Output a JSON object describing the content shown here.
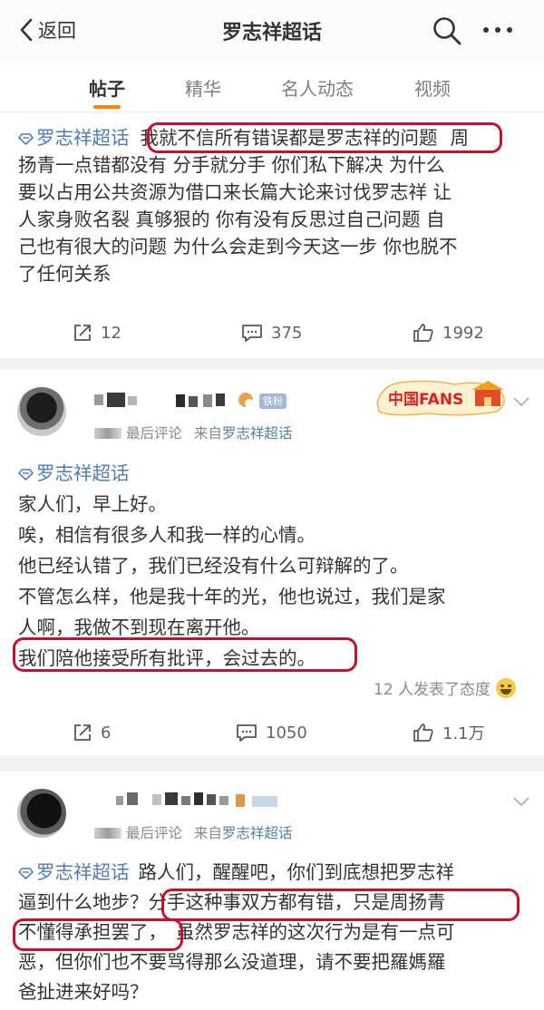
{
  "nav": {
    "back_label": "返回",
    "title": "罗志祥超话"
  },
  "tabs": [
    {
      "label": "帖子",
      "active": true
    },
    {
      "label": "精华",
      "active": false
    },
    {
      "label": "名人动态",
      "active": false
    },
    {
      "label": "视频",
      "active": false
    }
  ],
  "colors": {
    "accent": "#ff8200",
    "link": "#507daf",
    "highlight_circle": "#c8102e",
    "background": "#f2f2f2"
  },
  "posts": [
    {
      "topic_tag": "罗志祥超话",
      "text_lines": [
        "我就不信所有错误都是罗志祥的问题",
        "周",
        "扬青一点错都没有  分手就分手  你们私下解决  为什么",
        "要以占用公共资源为借口来长篇大论来讨伐罗志祥  让",
        "人家身败名裂  真够狠的  你有没有反思过自己问题  自",
        "己也有很大的问题  为什么会走到今天这一步  你也脱不",
        "了任何关系"
      ],
      "reposts": "12",
      "comments": "375",
      "likes": "1992"
    },
    {
      "author_badge": "铁粉",
      "meta_prefix": "最后评论",
      "meta_from": "来自",
      "meta_source": "罗志祥超话",
      "topic_tag": "罗志祥超话",
      "text_lines": [
        "家人们，早上好。",
        "唉，相信有很多人和我一样的心情。",
        "他已经认错了，我们已经没有什么可辩解的了。",
        "不管怎么样，他是我十年的光，他也说过，我们是家",
        "人啊，我做不到现在离开他。",
        "我们陪他接受所有批评，会过去的。"
      ],
      "fans_badge": "中国FANS",
      "attitude_text": "12 人发表了态度",
      "reposts": "6",
      "comments": "1050",
      "likes": "1.1万"
    },
    {
      "meta_prefix": "最后评论",
      "meta_from": "来自",
      "meta_source": "罗志祥超话",
      "topic_tag": "罗志祥超话",
      "text_lines": [
        "路人们，醒醒吧，你们到底想把罗志祥",
        "逼到什么地步？",
        "分手这种事双方都有错，只是周扬青",
        "不懂得承担罢了，",
        "虽然罗志祥的这次行为是有一点可",
        "恶，但你们也不要骂得那么没道理，请不要把羅媽羅",
        "爸扯进来好吗？"
      ]
    }
  ]
}
